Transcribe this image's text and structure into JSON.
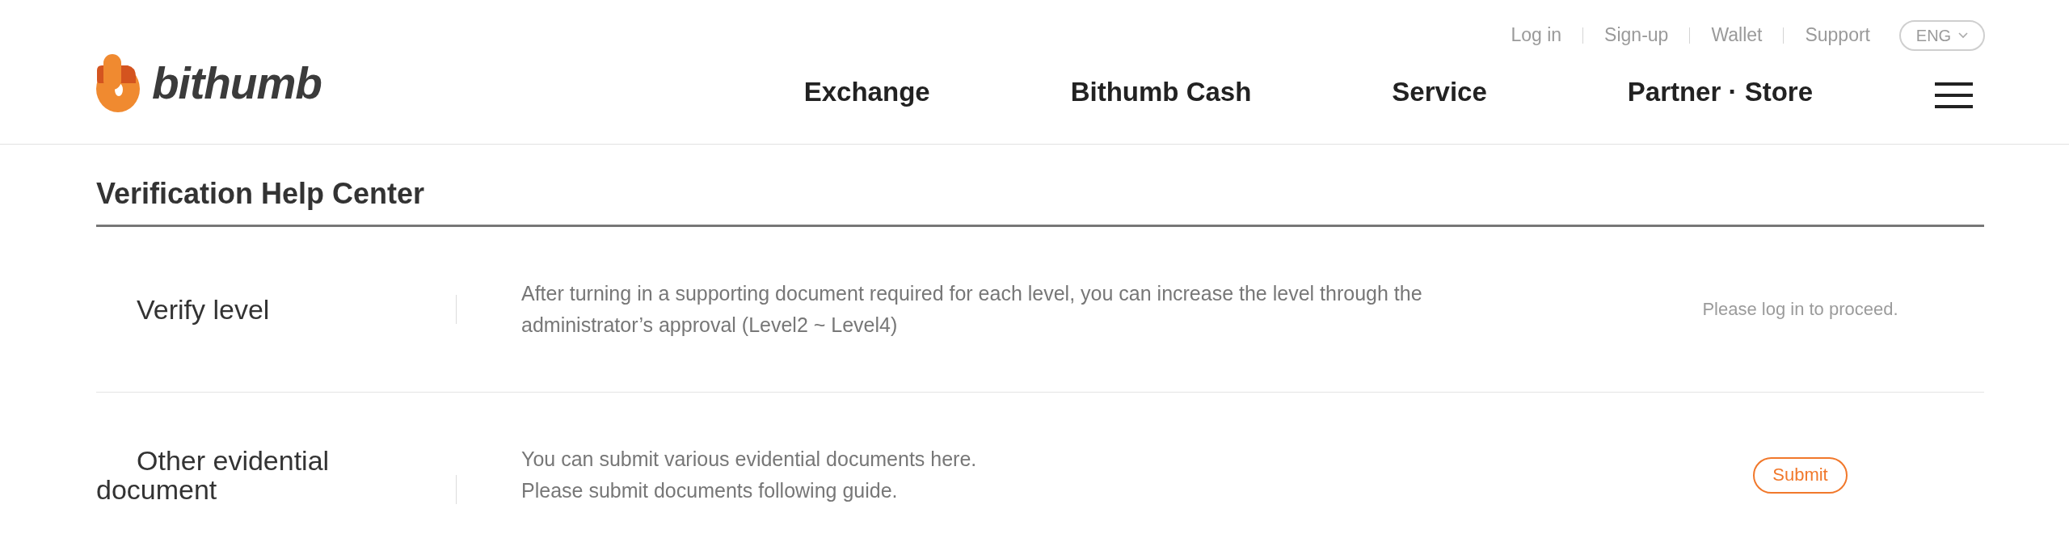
{
  "header": {
    "logo": {
      "wordmark": "bithumb"
    },
    "utility_links": [
      {
        "label": "Log in"
      },
      {
        "label": "Sign-up"
      },
      {
        "label": "Wallet"
      },
      {
        "label": "Support"
      }
    ],
    "language": {
      "label": "ENG"
    },
    "nav": [
      {
        "label": "Exchange"
      },
      {
        "label": "Bithumb Cash"
      },
      {
        "label": "Service"
      },
      {
        "label": "Partner · Store"
      }
    ]
  },
  "page": {
    "title": "Verification Help Center",
    "rows": [
      {
        "label": "Verify level",
        "description": "After turning in a supporting document required for each level, you can increase the level through the administrator’s approval (Level2 ~ Level4)",
        "action": {
          "kind": "note",
          "text": "Please log in to proceed."
        }
      },
      {
        "label": "Other evidential document",
        "description": "You can submit various evidential documents here.\nPlease submit documents following guide.",
        "action": {
          "kind": "button",
          "text": "Submit"
        }
      }
    ]
  }
}
